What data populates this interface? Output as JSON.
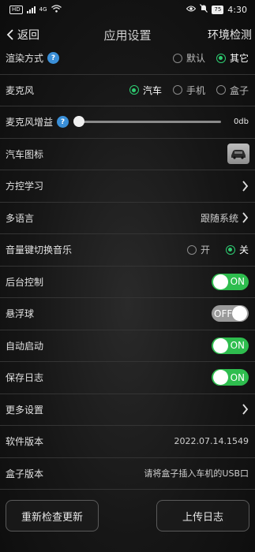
{
  "status_bar": {
    "hd_badge": "HD",
    "signal_label": "4G",
    "battery": "75",
    "time": "4:30"
  },
  "header": {
    "back_label": "返回",
    "title": "应用设置",
    "env_check_label": "环境检测"
  },
  "rows": {
    "render_mode": {
      "label": "渲染方式",
      "options": [
        "默认",
        "其它"
      ],
      "selected": "其它"
    },
    "mic": {
      "label": "麦克风",
      "options": [
        "汽车",
        "手机",
        "盒子"
      ],
      "selected": "汽车"
    },
    "mic_gain": {
      "label": "麦克风增益",
      "value": "0db",
      "level": 0
    },
    "car_icon": {
      "label": "汽车图标"
    },
    "steering": {
      "label": "方控学习"
    },
    "language": {
      "label": "多语言",
      "value": "跟随系统"
    },
    "volume_key": {
      "label": "音量键切换音乐",
      "options": [
        "开",
        "关"
      ],
      "selected": "关"
    },
    "background": {
      "label": "后台控制",
      "toggle": "ON"
    },
    "floating_ball": {
      "label": "悬浮球",
      "toggle": "OFF"
    },
    "auto_start": {
      "label": "自动启动",
      "toggle": "ON"
    },
    "save_log": {
      "label": "保存日志",
      "toggle": "ON"
    },
    "more": {
      "label": "更多设置"
    },
    "software_version": {
      "label": "软件版本",
      "value": "2022.07.14.1549"
    },
    "box_version": {
      "label": "盒子版本",
      "value": "请将盒子插入车机的USB口"
    }
  },
  "help_mark": "?",
  "footer": {
    "recheck_label": "重新检查更新",
    "upload_label": "上传日志"
  },
  "colors": {
    "accent_green": "#2ebd4e",
    "help_blue": "#3a8fd8"
  }
}
